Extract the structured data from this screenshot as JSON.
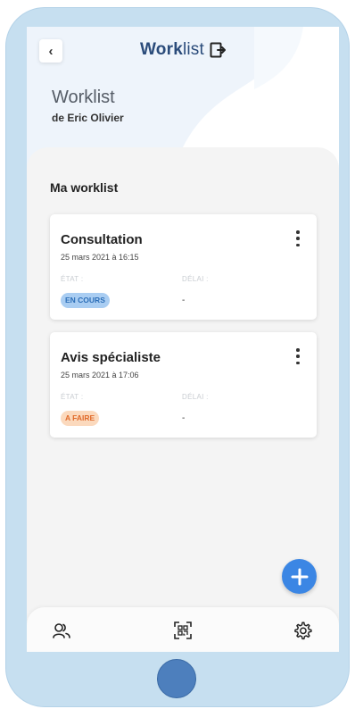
{
  "header": {
    "back_label": "‹",
    "app_title_bold": "Work",
    "app_title_rest": "list",
    "exit_icon": "exit-icon"
  },
  "page": {
    "heading": "Worklist",
    "subheading": "de Eric Olivier"
  },
  "section": {
    "title": "Ma worklist"
  },
  "cards": [
    {
      "title": "Consultation",
      "date": "25 mars 2021 à 16:15",
      "state_label": "ÉTAT :",
      "delay_label": "DÉLAI :",
      "state_value": "EN COURS",
      "delay_value": "-"
    },
    {
      "title": "Avis spécialiste",
      "date": "25 mars 2021 à 17:06",
      "state_label": "ÉTAT :",
      "delay_label": "DÉLAI :",
      "state_value": "A FAIRE",
      "delay_value": "-"
    }
  ],
  "nav": {
    "items": [
      "users-icon",
      "qr-scan-icon",
      "gear-icon"
    ]
  },
  "colors": {
    "phone_frame": "#c6dff0",
    "accent": "#3b86e4",
    "title": "#2a4b7a",
    "badge_in_progress": "#a9cdf2",
    "badge_todo": "#fbd9bd"
  }
}
